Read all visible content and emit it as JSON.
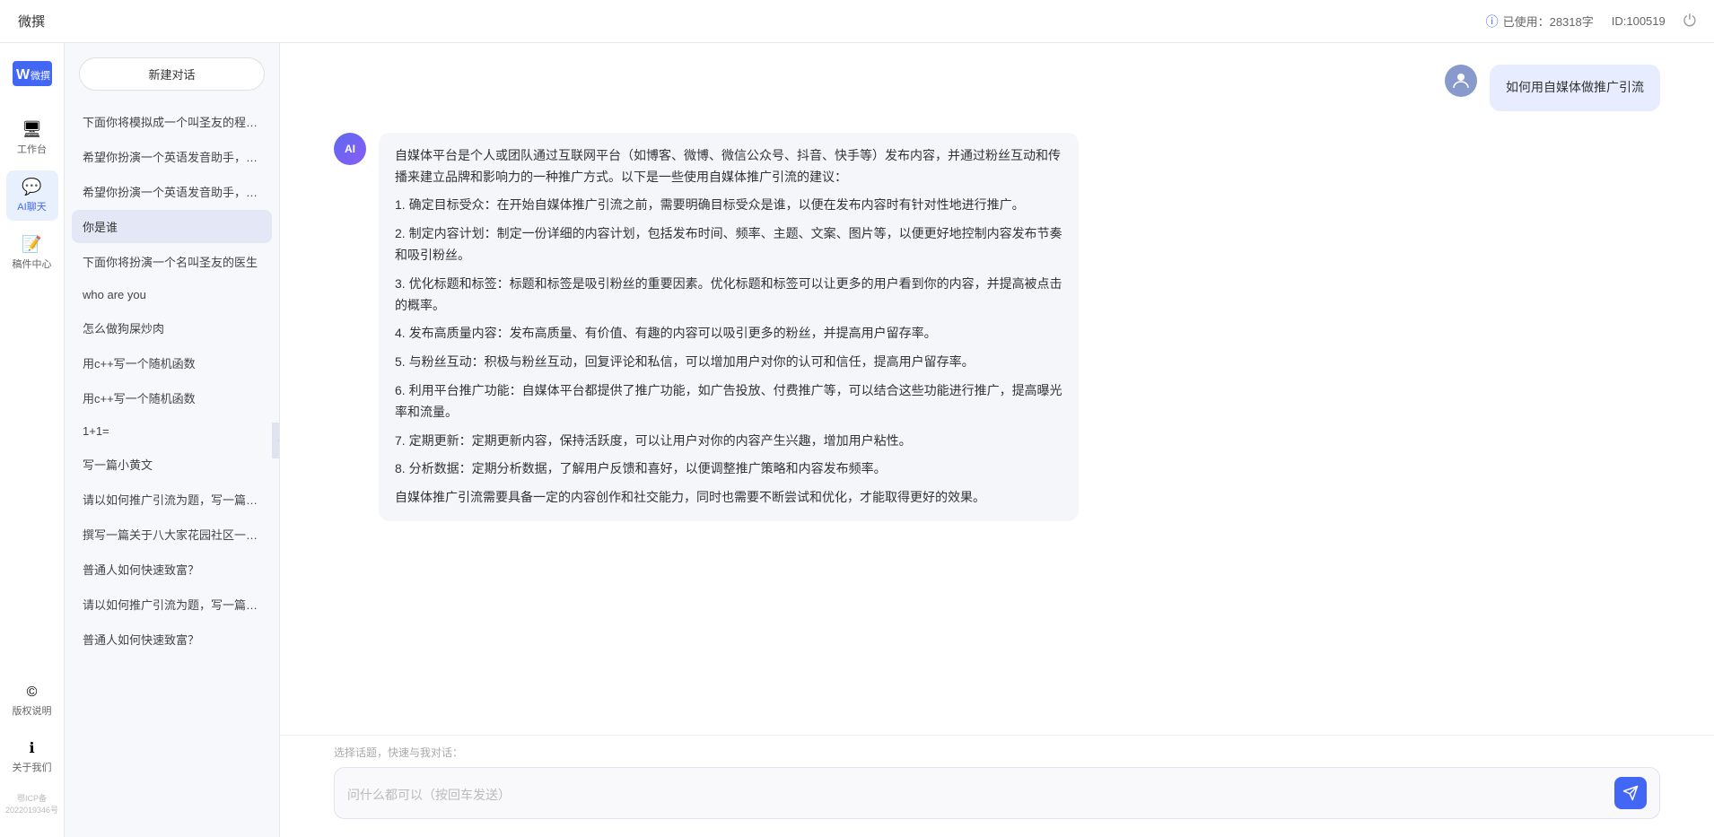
{
  "topbar": {
    "title": "微撰",
    "usage_label": "已使用：28318字",
    "id_label": "ID:100519",
    "usage_icon": "ℹ"
  },
  "logo": {
    "text": "W 微撰"
  },
  "nav": {
    "items": [
      {
        "id": "workbench",
        "icon": "🖥",
        "label": "工作台"
      },
      {
        "id": "ai-chat",
        "icon": "💬",
        "label": "AI聊天",
        "active": true
      },
      {
        "id": "drafts",
        "icon": "📝",
        "label": "稿件中心"
      }
    ],
    "bottom_items": [
      {
        "id": "copyright",
        "icon": "©",
        "label": "版权说明"
      },
      {
        "id": "about",
        "icon": "ℹ",
        "label": "关于我们"
      }
    ],
    "icp": "鄂ICP备2022019346号"
  },
  "sidebar": {
    "new_chat_label": "新建对话",
    "conversations": [
      {
        "id": 1,
        "text": "下面你将模拟成一个叫圣友的程序员，我说..."
      },
      {
        "id": 2,
        "text": "希望你扮演一个英语发音助手，我提供给你..."
      },
      {
        "id": 3,
        "text": "希望你扮演一个英语发音助手，我提供给你..."
      },
      {
        "id": 4,
        "text": "你是谁",
        "active": true
      },
      {
        "id": 5,
        "text": "下面你将扮演一个名叫圣友的医生"
      },
      {
        "id": 6,
        "text": "who are you"
      },
      {
        "id": 7,
        "text": "怎么做狗屎炒肉"
      },
      {
        "id": 8,
        "text": "用c++写一个随机函数"
      },
      {
        "id": 9,
        "text": "用c++写一个随机函数"
      },
      {
        "id": 10,
        "text": "1+1="
      },
      {
        "id": 11,
        "text": "写一篇小黄文"
      },
      {
        "id": 12,
        "text": "请以如何推广引流为题，写一篇大纲"
      },
      {
        "id": 13,
        "text": "撰写一篇关于八大家花园社区一刻钟便民生..."
      },
      {
        "id": 14,
        "text": "普通人如何快速致富？"
      },
      {
        "id": 15,
        "text": "请以如何推广引流为题，写一篇大纲"
      },
      {
        "id": 16,
        "text": "普通人如何快速致富？"
      }
    ]
  },
  "chat": {
    "messages": [
      {
        "id": 1,
        "role": "user",
        "text": "如何用自媒体做推广引流",
        "avatar_type": "user"
      },
      {
        "id": 2,
        "role": "ai",
        "paragraphs": [
          "自媒体平台是个人或团队通过互联网平台（如博客、微博、微信公众号、抖音、快手等）发布内容，并通过粉丝互动和传播来建立品牌和影响力的一种推广方式。以下是一些使用自媒体推广引流的建议：",
          "1. 确定目标受众：在开始自媒体推广引流之前，需要明确目标受众是谁，以便在发布内容时有针对性地进行推广。",
          "2. 制定内容计划：制定一份详细的内容计划，包括发布时间、频率、主题、文案、图片等，以便更好地控制内容发布节奏和吸引粉丝。",
          "3. 优化标题和标签：标题和标签是吸引粉丝的重要因素。优化标题和标签可以让更多的用户看到你的内容，并提高被点击的概率。",
          "4. 发布高质量内容：发布高质量、有价值、有趣的内容可以吸引更多的粉丝，并提高用户留存率。",
          "5. 与粉丝互动：积极与粉丝互动，回复评论和私信，可以增加用户对你的认可和信任，提高用户留存率。",
          "6. 利用平台推广功能：自媒体平台都提供了推广功能，如广告投放、付费推广等，可以结合这些功能进行推广，提高曝光率和流量。",
          "7. 定期更新：定期更新内容，保持活跃度，可以让用户对你的内容产生兴趣，增加用户粘性。",
          "8. 分析数据：定期分析数据，了解用户反馈和喜好，以便调整推广策略和内容发布频率。",
          "自媒体推广引流需要具备一定的内容创作和社交能力，同时也需要不断尝试和优化，才能取得更好的效果。"
        ],
        "avatar_type": "ai"
      }
    ],
    "input_placeholder": "问什么都可以（按回车发送）",
    "quick_topics_label": "选择话题，快速与我对话："
  }
}
